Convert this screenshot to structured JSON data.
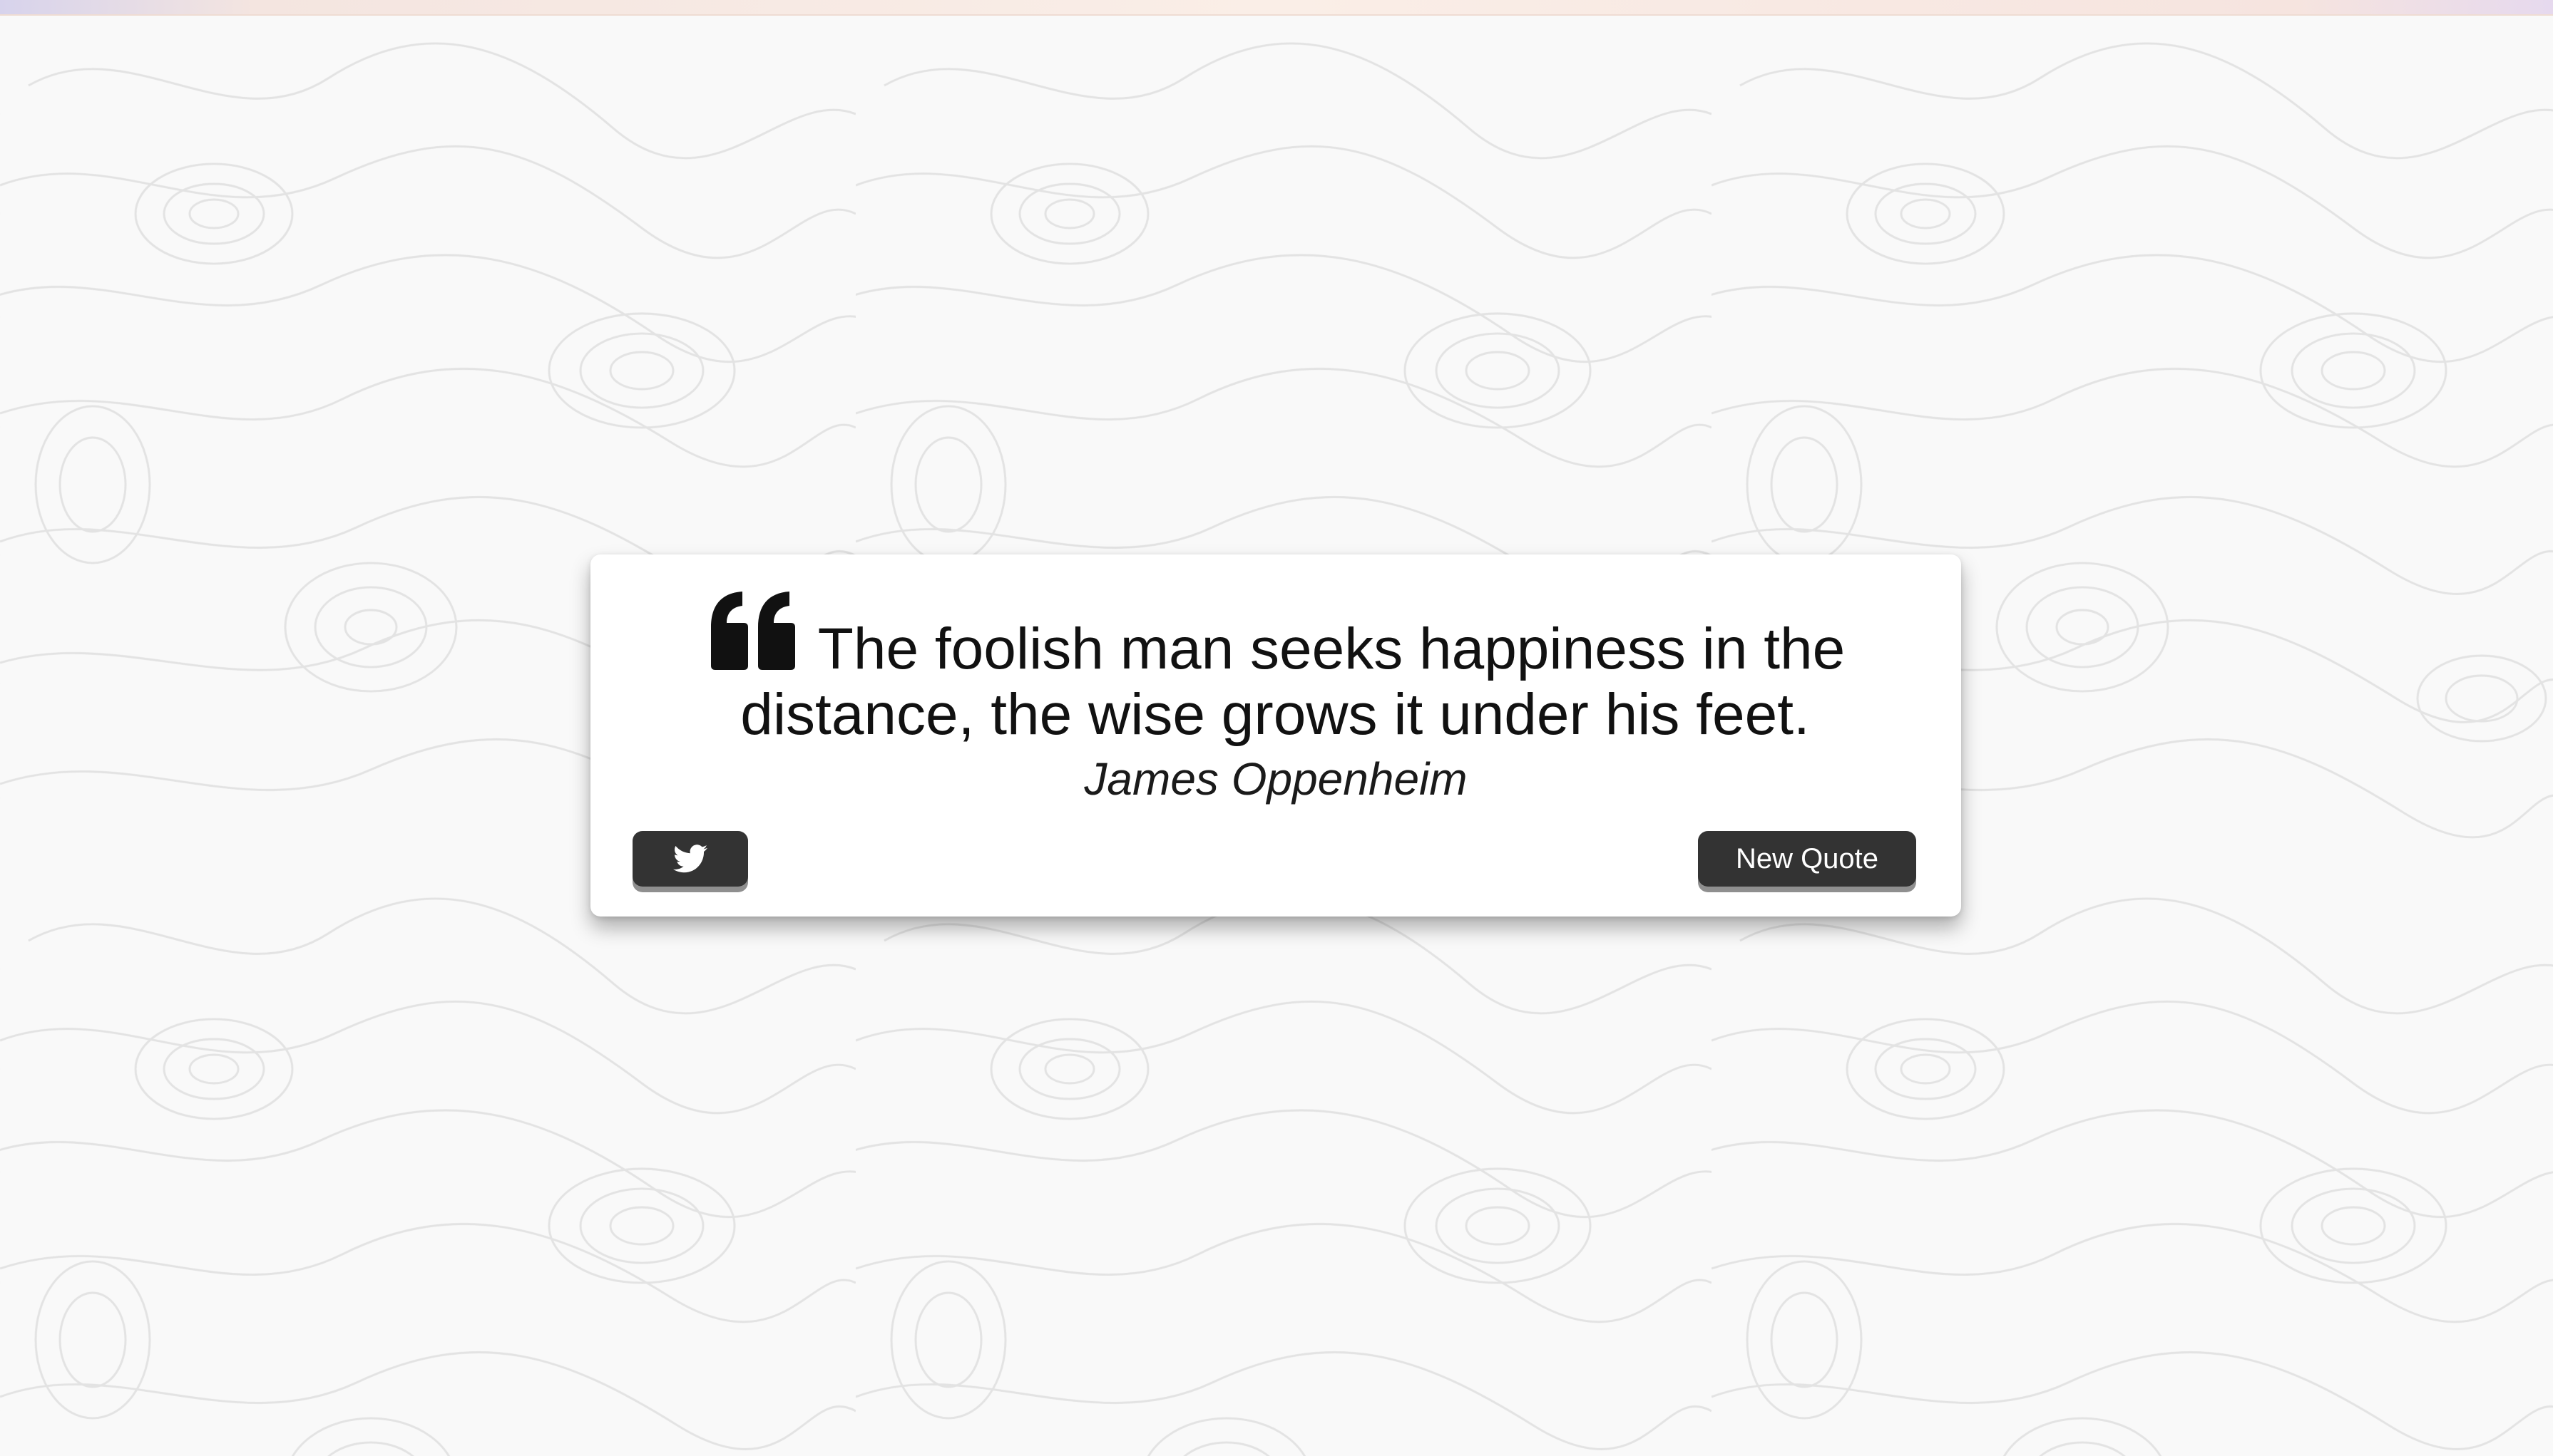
{
  "quote": {
    "icon": "quote-left-icon",
    "text": "The foolish man seeks happiness in the distance, the wise grows it under his feet.",
    "author": "James Oppenheim"
  },
  "actions": {
    "tweet_icon": "twitter-icon",
    "new_quote_label": "New Quote"
  },
  "colors": {
    "button_bg": "#333333",
    "button_text": "#ffffff",
    "card_bg": "#ffffff",
    "page_bg": "#f9f9f9",
    "text": "#111111"
  }
}
